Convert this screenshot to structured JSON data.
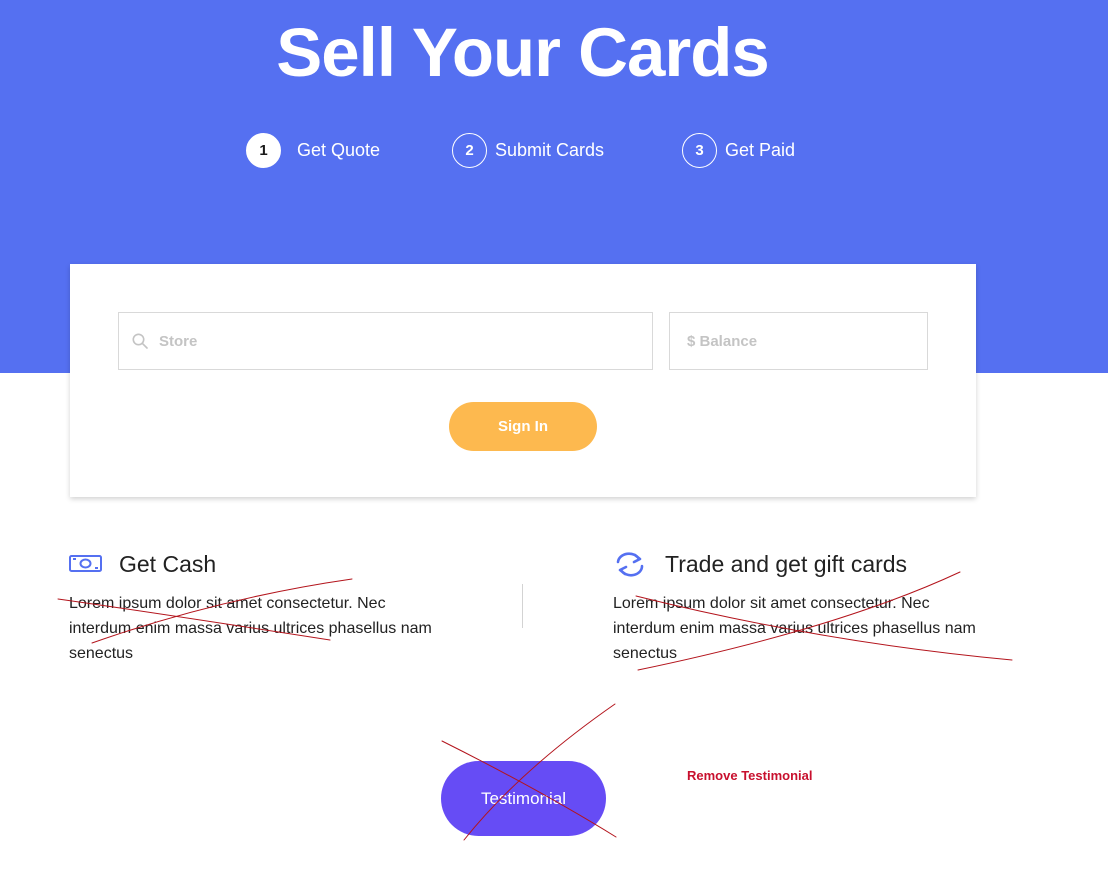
{
  "hero": {
    "title": "Sell Your Cards",
    "steps": [
      {
        "number": "1",
        "label": "Get Quote",
        "active": true
      },
      {
        "number": "2",
        "label": "Submit Cards",
        "active": false
      },
      {
        "number": "3",
        "label": "Get Paid",
        "active": false
      }
    ]
  },
  "quote_form": {
    "store_placeholder": "Store",
    "balance_placeholder": "$ Balance",
    "signin_label": "Sign In"
  },
  "features": [
    {
      "icon": "cash-icon",
      "title": "Get Cash",
      "text": "Lorem ipsum dolor sit amet consectetur. Nec interdum enim massa varius ultrices phasellus nam senectus"
    },
    {
      "icon": "refresh-icon",
      "title": "Trade and get gift cards",
      "text": "Lorem ipsum dolor sit amet consectetur. Nec interdum enim massa varius ultrices phasellus nam senectus"
    }
  ],
  "testimonial": {
    "label": "Testimonial"
  },
  "annotation": {
    "note": "Remove Testimonial"
  },
  "colors": {
    "hero_bg": "#5570f1",
    "signin_bg": "#fdb94f",
    "testimonial_bg": "#664cf5",
    "annotation_red": "#c8102e"
  }
}
